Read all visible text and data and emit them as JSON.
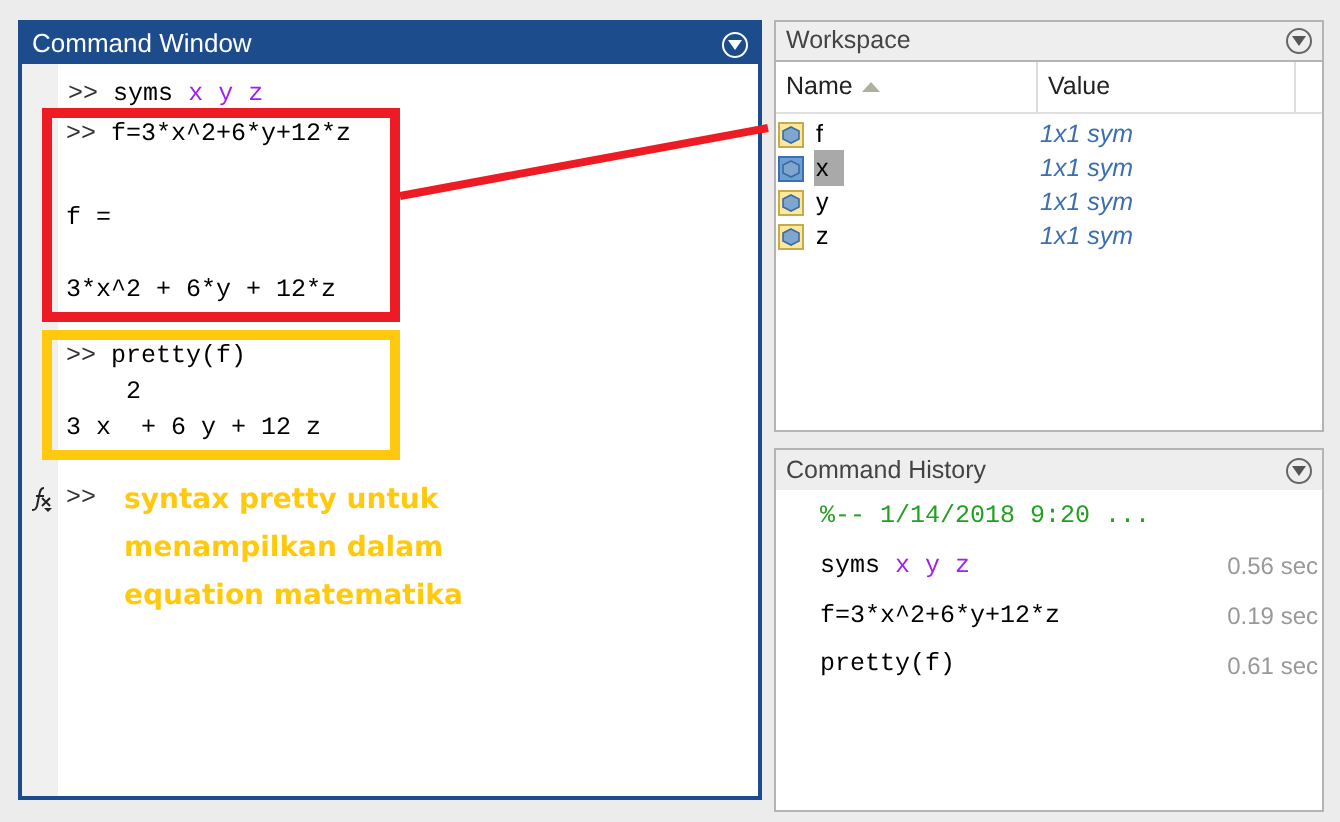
{
  "command_window": {
    "title": "Command Window",
    "lines": [
      {
        "kind": "input",
        "prompt": ">>",
        "parts": [
          {
            "text": "syms",
            "kind": "plain"
          },
          {
            "text": "x y z",
            "kind": "arg"
          }
        ]
      }
    ],
    "boxes": [
      {
        "color": "#ed1c24",
        "lines": [
          {
            "kind": "input",
            "prompt": ">>",
            "parts": [
              {
                "text": "f=3*x^2+6*y+12*z",
                "kind": "plain"
              }
            ]
          },
          {
            "kind": "label",
            "parts": [
              {
                "text": "f =",
                "kind": "plain"
              }
            ]
          },
          {
            "kind": "value",
            "parts": [
              {
                "text": "3*x^2 + 6*y + 12*z",
                "kind": "plain"
              }
            ]
          }
        ]
      },
      {
        "color": "#ffc90e",
        "lines": [
          {
            "kind": "input",
            "prompt": ">>",
            "parts": [
              {
                "text": "pretty(f)",
                "kind": "plain"
              }
            ]
          },
          {
            "kind": "exponent",
            "parts": [
              {
                "text": "2",
                "kind": "plain"
              }
            ]
          },
          {
            "kind": "pretty",
            "parts": [
              {
                "text": "3 x  + 6 y + 12 z",
                "kind": "plain"
              }
            ]
          }
        ]
      }
    ],
    "current_prompt": ">>",
    "annotation": {
      "color": "#ffc90e",
      "lines": [
        "syntax pretty untuk",
        "menampilkan dalam",
        "equation matematika"
      ]
    }
  },
  "workspace": {
    "title": "Workspace",
    "columns": [
      "Name",
      "Value"
    ],
    "rows": [
      {
        "name": "f",
        "value": "1x1 sym",
        "selected": false
      },
      {
        "name": "x",
        "value": "1x1 sym",
        "selected": true
      },
      {
        "name": "y",
        "value": "1x1 sym",
        "selected": false
      },
      {
        "name": "z",
        "value": "1x1 sym",
        "selected": false
      }
    ]
  },
  "command_history": {
    "title": "Command History",
    "session": "%-- 1/14/2018 9:20 ...",
    "entries": [
      {
        "parts": [
          {
            "text": "syms",
            "kind": "plain"
          },
          {
            "text": "x y z",
            "kind": "arg"
          }
        ],
        "time": "0.56 sec"
      },
      {
        "parts": [
          {
            "text": "f=3*x^2+6*y+12*z",
            "kind": "plain"
          }
        ],
        "time": "0.19 sec"
      },
      {
        "parts": [
          {
            "text": "pretty(f)",
            "kind": "plain"
          }
        ],
        "time": "0.61 sec"
      }
    ]
  }
}
